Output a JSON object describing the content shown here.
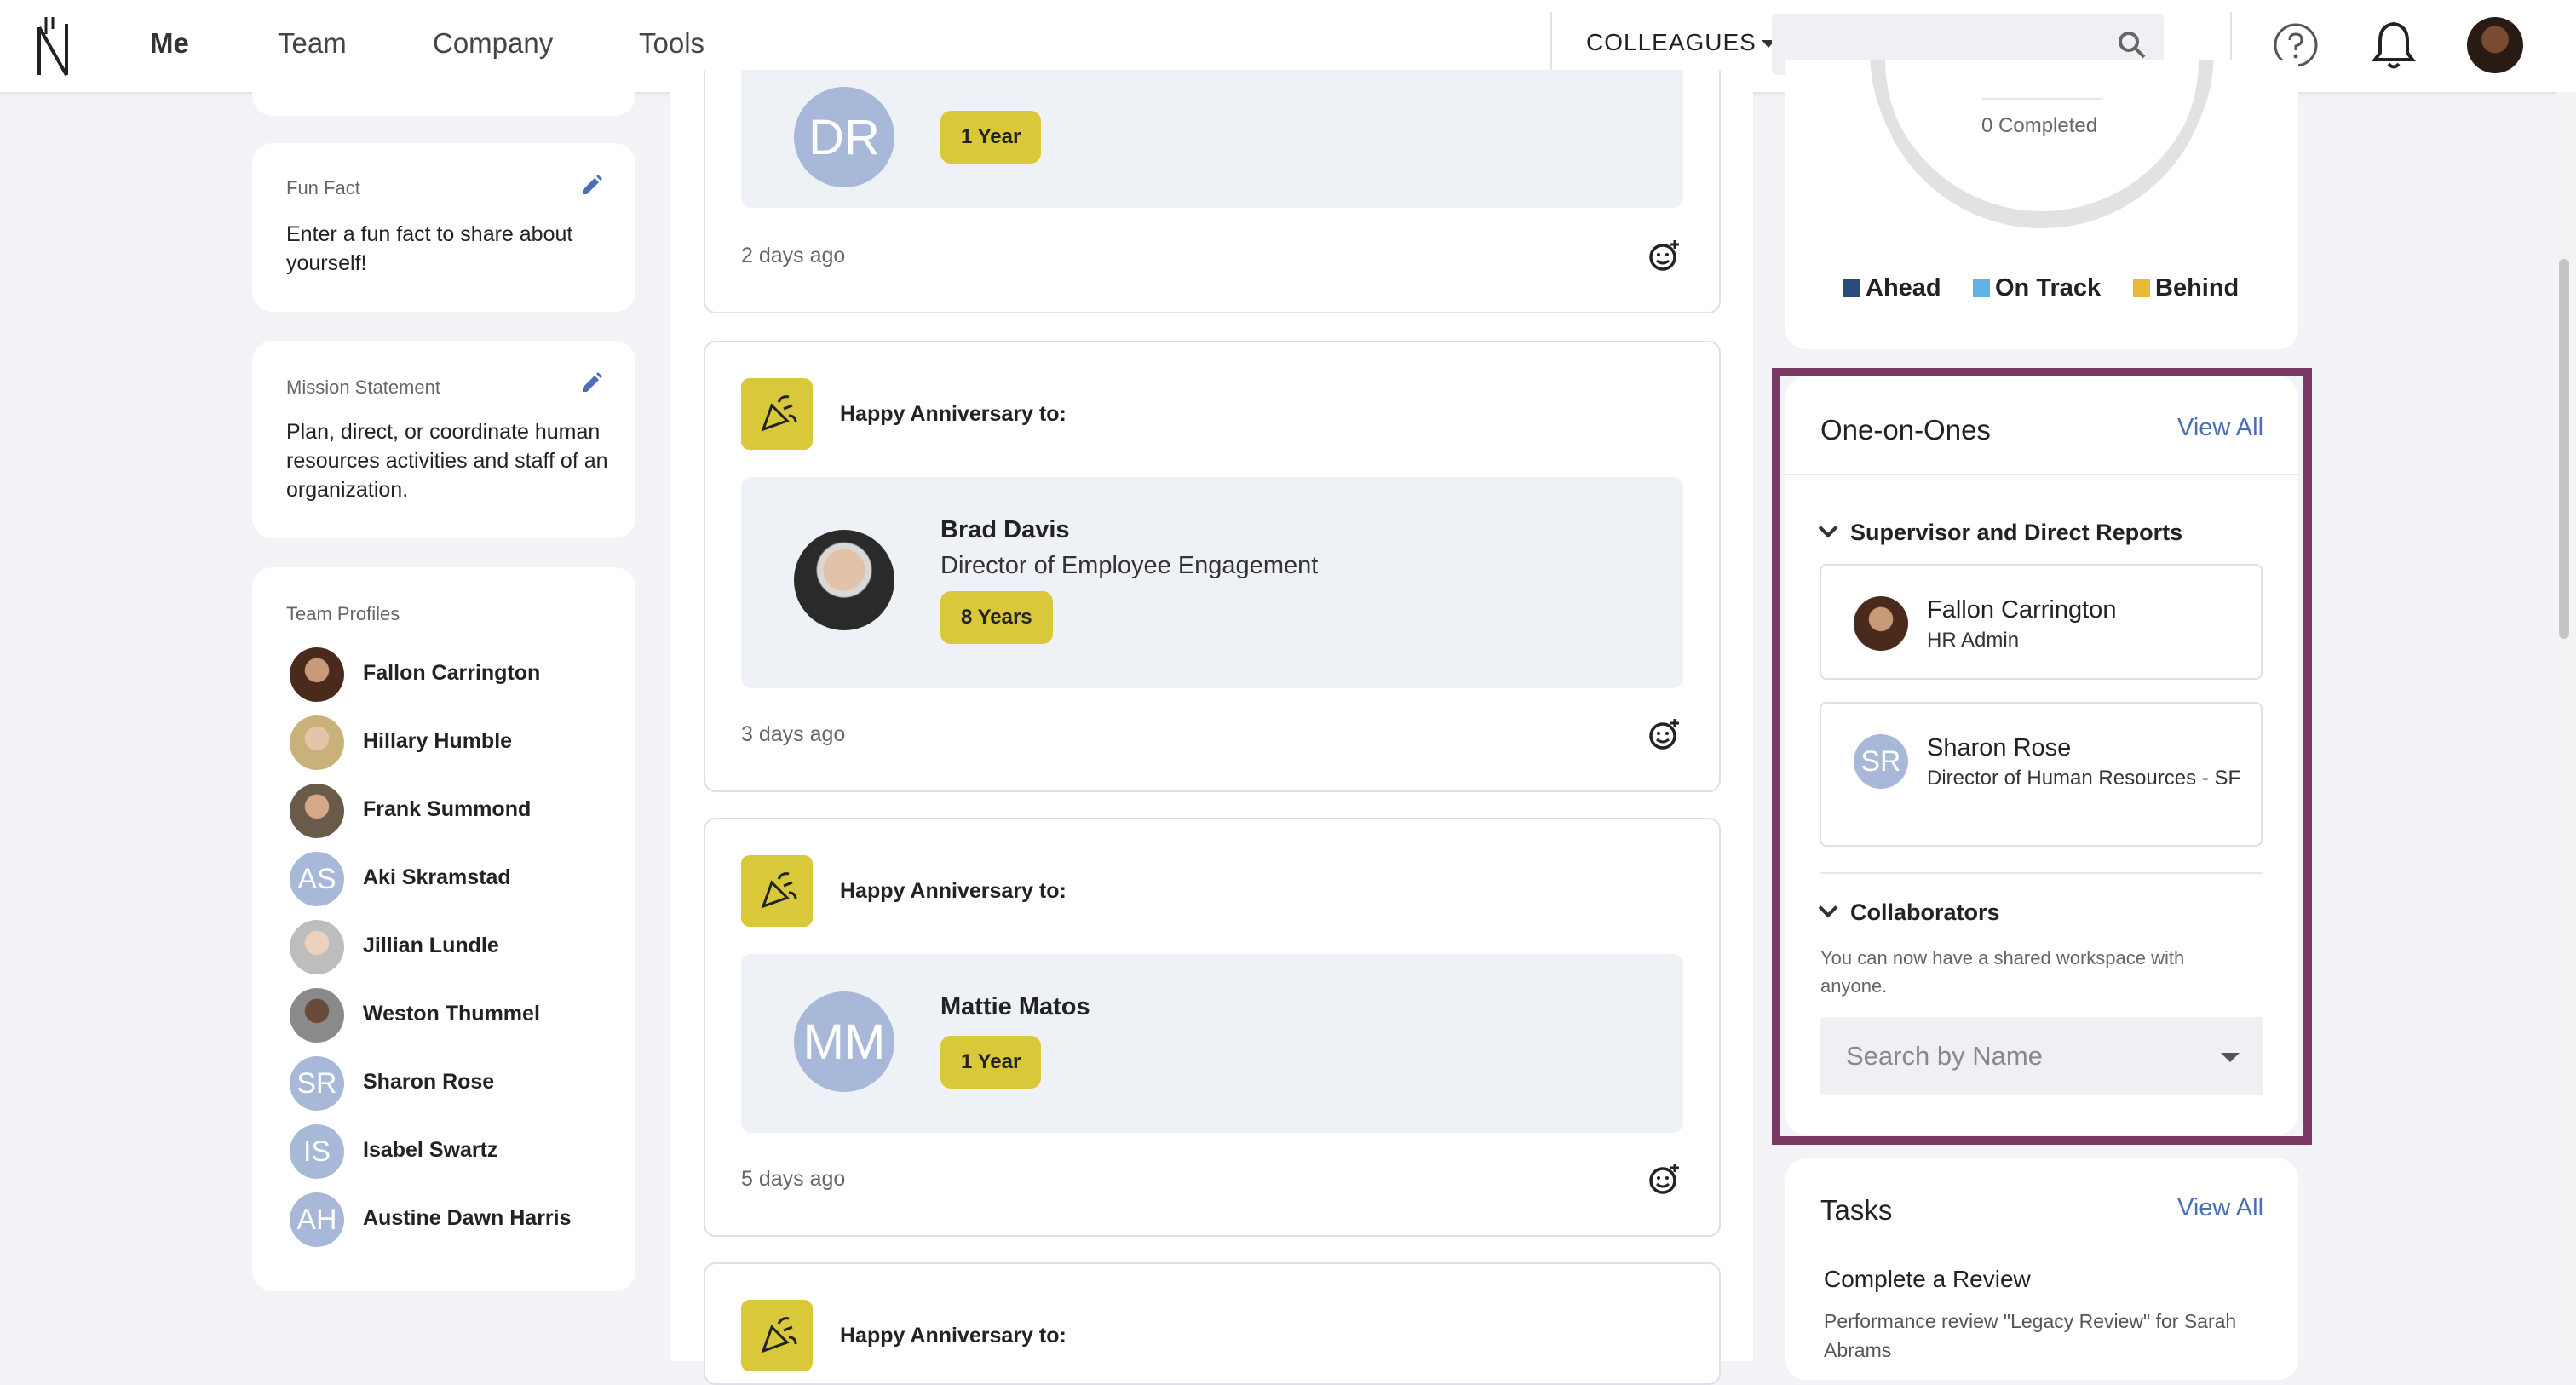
{
  "nav": {
    "items": [
      {
        "label": "Me"
      },
      {
        "label": "Team"
      },
      {
        "label": "Company"
      },
      {
        "label": "Tools"
      }
    ],
    "colleagues_label": "COLLEAGUES",
    "search_placeholder": ""
  },
  "left": {
    "fun_fact": {
      "title": "Fun Fact",
      "text": "Enter a fun fact to share about yourself!"
    },
    "mission": {
      "title": "Mission Statement",
      "text": "Plan, direct, or coordinate human resources activities and staff of an organization."
    },
    "team_profiles": {
      "title": "Team Profiles",
      "members": [
        {
          "name": "Fallon Carrington",
          "initials": ""
        },
        {
          "name": "Hillary Humble",
          "initials": ""
        },
        {
          "name": "Frank Summond",
          "initials": ""
        },
        {
          "name": "Aki Skramstad",
          "initials": "AS"
        },
        {
          "name": "Jillian Lundle",
          "initials": ""
        },
        {
          "name": "Weston Thummel",
          "initials": ""
        },
        {
          "name": "Sharon Rose",
          "initials": "SR"
        },
        {
          "name": "Isabel Swartz",
          "initials": "IS"
        },
        {
          "name": "Austine Dawn Harris",
          "initials": "AH"
        }
      ]
    }
  },
  "feed": {
    "card0": {
      "initials": "DR",
      "badge": "1 Year",
      "time": "2 days ago"
    },
    "card1": {
      "heading": "Happy Anniversary to:",
      "name": "Brad Davis",
      "title": "Director of Employee Engagement",
      "badge": "8 Years",
      "time": "3 days ago"
    },
    "card2": {
      "heading": "Happy Anniversary to:",
      "initials": "MM",
      "name": "Mattie Matos",
      "badge": "1 Year",
      "time": "5 days ago"
    },
    "card3": {
      "heading": "Happy Anniversary to:"
    }
  },
  "right": {
    "goals": {
      "completed_label": "0 Completed",
      "legend": [
        {
          "label": "Ahead",
          "color": "#2a4a7f"
        },
        {
          "label": "On Track",
          "color": "#5fb1e6"
        },
        {
          "label": "Behind",
          "color": "#e8b93a"
        }
      ]
    },
    "one_on_ones": {
      "title": "One-on-Ones",
      "view_all": "View All",
      "supervisor_section": "Supervisor and Direct Reports",
      "people": [
        {
          "name": "Fallon Carrington",
          "role": "HR Admin",
          "initials": ""
        },
        {
          "name": "Sharon Rose",
          "role": "Director of Human Resources - SF",
          "initials": "SR"
        }
      ],
      "collaborators_section": "Collaborators",
      "collaborators_note": "You can now have a shared workspace with anyone.",
      "search_placeholder": "Search by Name"
    },
    "tasks": {
      "title": "Tasks",
      "view_all": "View All",
      "item_title": "Complete a Review",
      "item_desc": "Performance review \"Legacy Review\" for Sarah Abrams"
    }
  },
  "colors": {
    "accent": "#4a6fb5",
    "highlight_border": "#7b3a63",
    "badge": "#d9c93a"
  }
}
